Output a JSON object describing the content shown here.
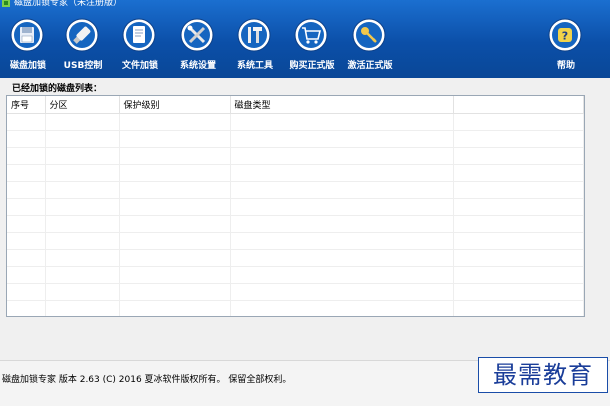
{
  "window": {
    "title": "磁盘加锁专家（未注册版）"
  },
  "toolbar": {
    "items": [
      {
        "label": "磁盘加锁",
        "icon": "floppy-disk-icon"
      },
      {
        "label": "USB控制",
        "icon": "usb-drive-icon"
      },
      {
        "label": "文件加锁",
        "icon": "document-icon"
      },
      {
        "label": "系统设置",
        "icon": "tools-icon"
      },
      {
        "label": "系统工具",
        "icon": "screwdriver-hammer-icon"
      },
      {
        "label": "购买正式版",
        "icon": "shopping-cart-icon"
      },
      {
        "label": "激活正式版",
        "icon": "key-icon"
      },
      {
        "label": "帮助",
        "icon": "help-icon"
      }
    ]
  },
  "disk_list": {
    "label": "已经加锁的磁盘列表：",
    "columns": [
      "序号",
      "分区",
      "保护级别",
      "磁盘类型",
      ""
    ],
    "rows": []
  },
  "status": {
    "text": "磁盘加锁专家 版本 2.63 (C)  2016 夏冰软件版权所有。 保留全部权利。"
  },
  "watermark": {
    "text": "最需教育"
  },
  "colors": {
    "toolbar_top": "#1b6fd0",
    "toolbar_bottom": "#0a4797",
    "icon_ring": "#0d3f86",
    "watermark": "#1a3d99"
  }
}
